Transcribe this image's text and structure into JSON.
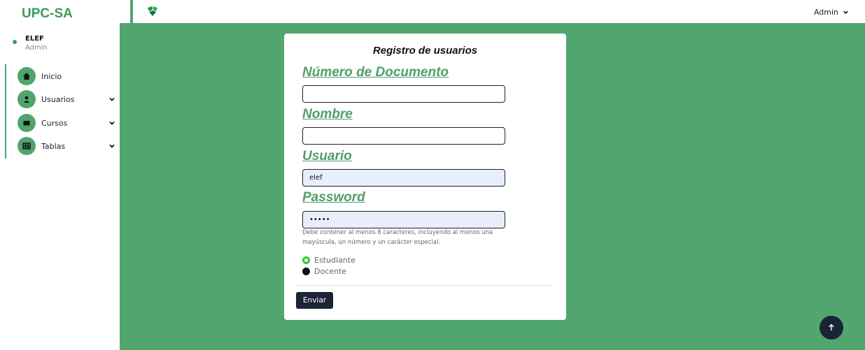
{
  "sidebar": {
    "brand": "UPC-SA",
    "user": {
      "name": "ELEF",
      "role": "Admin"
    },
    "items": [
      {
        "label": "Inicio",
        "icon": "home-icon"
      },
      {
        "label": "Usuarios",
        "icon": "user-icon",
        "has_submenu": true
      },
      {
        "label": "Cursos",
        "icon": "book-icon",
        "has_submenu": true
      },
      {
        "label": "Tablas",
        "icon": "table-icon",
        "has_submenu": true
      }
    ]
  },
  "topbar": {
    "admin_label": "Admin"
  },
  "form": {
    "title": "Registro de usuarios",
    "fields": {
      "documento": {
        "label": "Número de Documento",
        "value": ""
      },
      "nombre": {
        "label": "Nombre",
        "value": ""
      },
      "usuario": {
        "label": "Usuario",
        "value": "elef"
      },
      "password": {
        "label": "Password",
        "value": "•••••"
      }
    },
    "password_hint": "Debe contener al menos 8 caracteres, incluyendo al menos una mayúscula, un número y un carácter especial.",
    "roles": [
      {
        "label": "Estudiante",
        "selected": true
      },
      {
        "label": "Docente",
        "selected": false
      }
    ],
    "submit_label": "Enviar"
  },
  "colors": {
    "accent": "#50a66e",
    "label_green": "#4f9e68",
    "dark_button": "#1b2436",
    "radio_selected": "#2ecc32"
  }
}
